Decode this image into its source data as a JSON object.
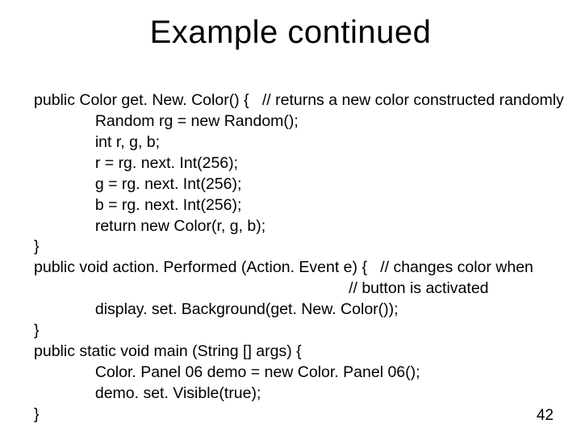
{
  "title": "Example continued",
  "code": {
    "l01": "public Color get. New. Color() {   // returns a new color constructed randomly",
    "l02": "              Random rg = new Random();",
    "l03": "              int r, g, b;",
    "l04": "              r = rg. next. Int(256);",
    "l05": "              g = rg. next. Int(256);",
    "l06": "              b = rg. next. Int(256);",
    "l07": "              return new Color(r, g, b);",
    "l08": "}",
    "l09": "public void action. Performed (Action. Event e) {   // changes color when",
    "l10": "                                                                        // button is activated",
    "l11": "              display. set. Background(get. New. Color());",
    "l12": "}",
    "l13": "public static void main (String [] args) {",
    "l14": "              Color. Panel 06 demo = new Color. Panel 06();",
    "l15": "              demo. set. Visible(true);",
    "l16": "}"
  },
  "page_number": "42"
}
